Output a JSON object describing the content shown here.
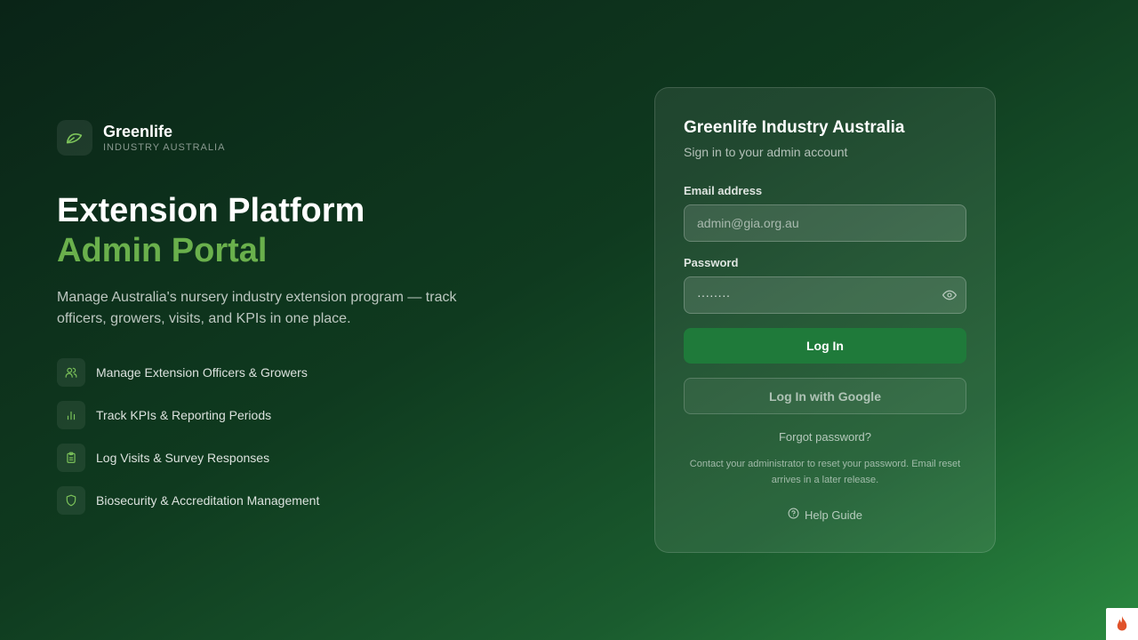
{
  "brand": {
    "name": "Greenlife",
    "subtitle": "INDUSTRY AUSTRALIA"
  },
  "hero": {
    "title_line1": "Extension Platform",
    "title_line2": "Admin Portal",
    "description": "Manage Australia's nursery industry extension program — track officers, growers, visits, and KPIs in one place."
  },
  "features": [
    {
      "icon": "users-icon",
      "label": "Manage Extension Officers & Growers"
    },
    {
      "icon": "bar-chart-icon",
      "label": "Track KPIs & Reporting Periods"
    },
    {
      "icon": "clipboard-icon",
      "label": "Log Visits & Survey Responses"
    },
    {
      "icon": "shield-icon",
      "label": "Biosecurity & Accreditation Management"
    }
  ],
  "login": {
    "title": "Greenlife Industry Australia",
    "subtitle": "Sign in to your admin account",
    "email_label": "Email address",
    "email_placeholder": "admin@gia.org.au",
    "password_label": "Password",
    "password_value": "········",
    "login_button": "Log In",
    "google_button": "Log In with Google",
    "forgot_link": "Forgot password?",
    "note": "Contact your administrator to reset your password. Email reset arrives in a later release.",
    "help_link": "Help Guide"
  },
  "colors": {
    "accent": "#6ab04c",
    "primary_button": "#1f7a3a"
  }
}
